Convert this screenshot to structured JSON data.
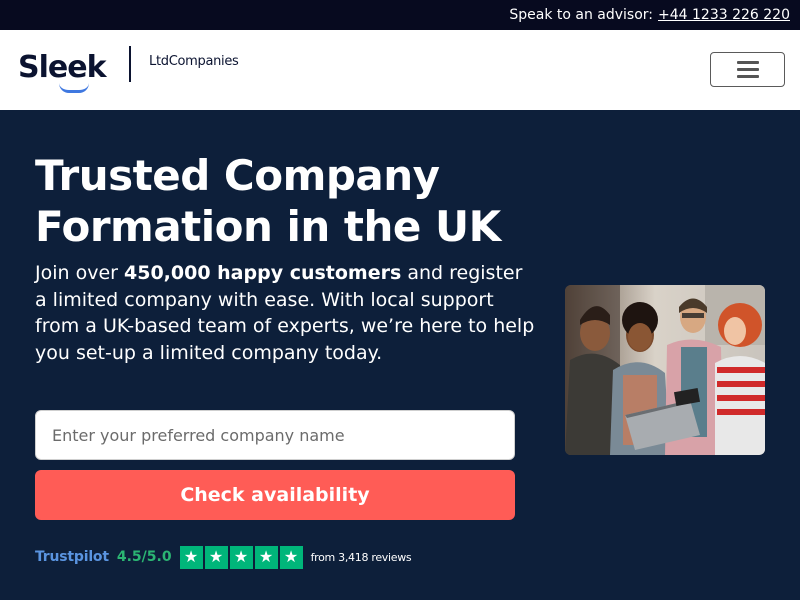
{
  "topbar": {
    "advisor_label": "Speak to an advisor:",
    "phone": "+44 1233 226 220"
  },
  "header": {
    "logo_text": "Sleek",
    "logo_sub": "LtdCompanies",
    "menu_icon": "hamburger-menu-icon"
  },
  "hero": {
    "title": "Trusted Company Formation in the UK",
    "text_part1": "Join over ",
    "text_bold": "450,000 happy customers",
    "text_part2": " and register a limited company with ease. With local support from a UK-based team of experts, we’re here to help you set-up a limited company today.",
    "search_placeholder": "Enter your preferred company name",
    "search_value": "",
    "check_button": "Check availability"
  },
  "trustpilot": {
    "brand": "Trustpilot",
    "score": "4.5/5.0",
    "stars": 5,
    "reviews": "from 3,418 reviews"
  },
  "colors": {
    "hero_bg": "#0d1f3a",
    "topbar_bg": "#070a1f",
    "accent": "#ff5c56",
    "trust_green": "#00b67a",
    "logo_blue": "#3f78e0"
  }
}
